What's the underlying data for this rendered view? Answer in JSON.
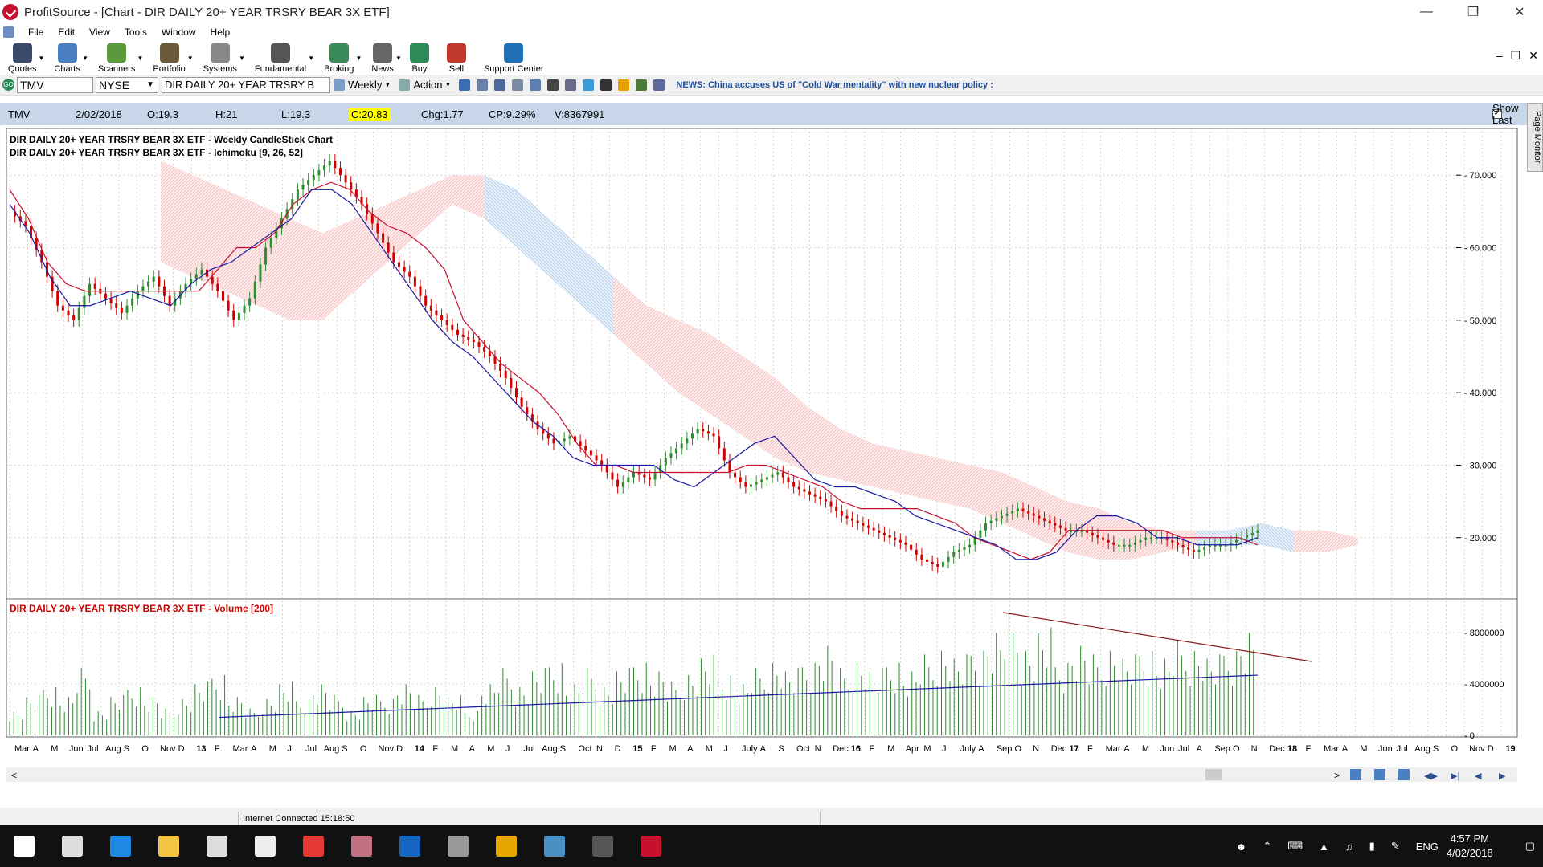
{
  "window": {
    "title": "ProfitSource - [Chart - DIR DAILY 20+ YEAR TRSRY BEAR 3X ETF]"
  },
  "menu": [
    "File",
    "Edit",
    "View",
    "Tools",
    "Window",
    "Help"
  ],
  "toolbar": [
    {
      "label": "Quotes",
      "icon": "quotes-icon",
      "color": "#3b4a6b"
    },
    {
      "label": "Charts",
      "icon": "charts-icon",
      "color": "#4a7fc1"
    },
    {
      "label": "Scanners",
      "icon": "scanners-icon",
      "color": "#5a9a3a"
    },
    {
      "label": "Portfolio",
      "icon": "portfolio-icon",
      "color": "#6b5a3a"
    },
    {
      "label": "Systems",
      "icon": "systems-icon",
      "color": "#888888"
    },
    {
      "label": "Fundamental",
      "icon": "fundamental-icon",
      "color": "#555555"
    },
    {
      "label": "Broking",
      "icon": "broking-icon",
      "color": "#3a8a5a"
    },
    {
      "label": "News",
      "icon": "news-icon",
      "color": "#666666"
    },
    {
      "label": "Buy",
      "icon": "buy-icon",
      "color": "#2e8b57"
    },
    {
      "label": "Sell",
      "icon": "sell-icon",
      "color": "#c0392b"
    },
    {
      "label": "Support Center",
      "icon": "help-icon",
      "color": "#1f6fb5"
    }
  ],
  "symbol_bar": {
    "symbol": "TMV",
    "exchange": "NYSE",
    "security": "DIR DAILY 20+ YEAR TRSRY B",
    "period": "Weekly",
    "action": "Action",
    "news": "NEWS: China accuses US of \"Cold War mentality\" with new nuclear policy :"
  },
  "info": {
    "symbol": "TMV",
    "date": "2/02/2018",
    "open": "O:19.3",
    "high": "H:21",
    "low": "L:19.3",
    "close": "C:20.83",
    "chg": "Chg:1.77",
    "cp": "CP:9.29%",
    "vol": "V:8367991",
    "show_last": "Show Last"
  },
  "page_monitor": "Page Monitor",
  "chart_data": {
    "type": "line",
    "title": "DIR DAILY 20+ YEAR TRSRY BEAR 3X ETF - Weekly CandleStick Chart",
    "indicator_label": "DIR DAILY 20+ YEAR TRSRY BEAR 3X ETF - Ichimoku [9, 26, 52]",
    "volume_label": "DIR DAILY 20+ YEAR TRSRY BEAR 3X ETF - Volume [200]",
    "price_ticks": [
      "70.000",
      "60.000",
      "50.000",
      "40.000",
      "30.000",
      "20.000"
    ],
    "price_tick_values": [
      70,
      60,
      50,
      40,
      30,
      20
    ],
    "ylim": [
      12,
      76
    ],
    "volume_ticks": [
      "8000000",
      "4000000",
      "0"
    ],
    "volume_tick_values": [
      8000000,
      4000000,
      0
    ],
    "volume_ylim": [
      0,
      10000000
    ],
    "x_labels": [
      "Mar",
      "A",
      "M",
      "Jun",
      "Jul",
      "Aug",
      "S",
      "O",
      "Nov",
      "D",
      "13",
      "F",
      "Mar",
      "A",
      "M",
      "J",
      "Jul",
      "Aug",
      "S",
      "O",
      "Nov",
      "D",
      "14",
      "F",
      "M",
      "A",
      "M",
      "J",
      "Jul",
      "Aug",
      "S",
      "Oct",
      "N",
      "D",
      "15",
      "F",
      "M",
      "A",
      "M",
      "J",
      "July",
      "A",
      "S",
      "Oct",
      "N",
      "Dec",
      "16",
      "F",
      "M",
      "Apr",
      "M",
      "J",
      "July",
      "A",
      "Sep",
      "O",
      "N",
      "Dec",
      "17",
      "F",
      "Mar",
      "A",
      "M",
      "Jun",
      "Jul",
      "A",
      "Sep",
      "O",
      "N",
      "Dec",
      "18",
      "F",
      "Mar",
      "A",
      "M",
      "Jun",
      "Jul",
      "Aug",
      "S",
      "O",
      "Nov",
      "D",
      "19"
    ],
    "close_series": [
      65,
      63,
      58,
      52,
      50,
      55,
      53,
      51,
      54,
      56,
      52,
      55,
      57,
      54,
      50,
      53,
      60,
      64,
      68,
      70,
      72,
      69,
      66,
      62,
      58,
      56,
      52,
      50,
      48,
      47,
      45,
      42,
      38,
      35,
      33,
      34,
      32,
      30,
      27,
      29,
      28,
      31,
      33,
      35,
      34,
      29,
      27,
      28,
      29,
      27,
      26,
      25,
      23,
      22,
      21,
      20,
      19,
      17,
      16,
      18,
      19,
      22,
      23,
      24,
      23,
      22,
      21,
      21,
      20,
      19,
      19,
      20,
      20,
      19,
      18,
      19,
      19,
      20,
      21
    ],
    "kijun_series": [
      68,
      64,
      58,
      55,
      54,
      54,
      54,
      54,
      54,
      54,
      54,
      57,
      60,
      60,
      62,
      66,
      68,
      69,
      68,
      65,
      63,
      62,
      60,
      57,
      50,
      47,
      44,
      42,
      40,
      37,
      33,
      30,
      30,
      29,
      29,
      29,
      29,
      29,
      29,
      30,
      30,
      29,
      28,
      27,
      25,
      24,
      24,
      24,
      24,
      23,
      22,
      20,
      19,
      18,
      17,
      18,
      21,
      21,
      21,
      21,
      21,
      21,
      20,
      20,
      20,
      20,
      19
    ],
    "tenkan_series": [
      66,
      62,
      56,
      52,
      52,
      53,
      54,
      53,
      52,
      55,
      57,
      58,
      60,
      62,
      64,
      68,
      68,
      66,
      62,
      58,
      54,
      50,
      47,
      45,
      42,
      39,
      36,
      34,
      31,
      30,
      30,
      30,
      30,
      28,
      27,
      29,
      31,
      33,
      34,
      31,
      28,
      27,
      27,
      26,
      25,
      23,
      22,
      21,
      20,
      19,
      17,
      17,
      18,
      21,
      23,
      23,
      22,
      20,
      20,
      19,
      19,
      19,
      20
    ],
    "cloud_upper": [
      72,
      70,
      68,
      66,
      64,
      62,
      64,
      66,
      68,
      70,
      70,
      68,
      64,
      60,
      56,
      52,
      50,
      48,
      45,
      42,
      38,
      35,
      33,
      32,
      31,
      30,
      29,
      27,
      25,
      24,
      22,
      21,
      21,
      21,
      22,
      21,
      21,
      20
    ],
    "cloud_lower": [
      58,
      56,
      54,
      52,
      50,
      50,
      54,
      58,
      62,
      66,
      64,
      60,
      56,
      52,
      48,
      44,
      40,
      37,
      34,
      31,
      29,
      28,
      27,
      26,
      25,
      24,
      22,
      20,
      18,
      17,
      17,
      18,
      19,
      19,
      19,
      18,
      18,
      19
    ],
    "volume_series": [
      2,
      3,
      4,
      3,
      5,
      2,
      3,
      4,
      3,
      2,
      3,
      4,
      5,
      3,
      2,
      3,
      4,
      3,
      4,
      3,
      2,
      3,
      3,
      4,
      3,
      4,
      3,
      2,
      4,
      5,
      4,
      5,
      6,
      4,
      5,
      4,
      5,
      6,
      5,
      4,
      5,
      6,
      5,
      4,
      5,
      6,
      5,
      6,
      7,
      5,
      6,
      5,
      6,
      5,
      6,
      7,
      6,
      7,
      8,
      9,
      7,
      8,
      6,
      7,
      6,
      7,
      6,
      7,
      6,
      7,
      7,
      6,
      7,
      8
    ]
  },
  "status": "Internet Connected 15:18:50",
  "clock": {
    "time": "4:57 PM",
    "date": "4/02/2018",
    "lang": "ENG"
  },
  "taskbar": [
    {
      "name": "start-icon",
      "color": "#ffffff"
    },
    {
      "name": "task-view-icon",
      "color": "#dddddd"
    },
    {
      "name": "edge-icon",
      "color": "#1e88e5"
    },
    {
      "name": "file-explorer-icon",
      "color": "#f4c542"
    },
    {
      "name": "store-icon",
      "color": "#dddddd"
    },
    {
      "name": "calculator-icon",
      "color": "#eeeeee"
    },
    {
      "name": "app-k-icon",
      "color": "#e53935"
    },
    {
      "name": "app-brush-icon",
      "color": "#c07080"
    },
    {
      "name": "shield-app-icon",
      "color": "#1565c0"
    },
    {
      "name": "camera-app-icon",
      "color": "#999999"
    },
    {
      "name": "chrome-icon",
      "color": "#e6a600"
    },
    {
      "name": "docs-app-icon",
      "color": "#4a90c2"
    },
    {
      "name": "go-app-icon",
      "color": "#555555"
    },
    {
      "name": "profitsource-taskbar-icon",
      "color": "#c8102e"
    }
  ]
}
